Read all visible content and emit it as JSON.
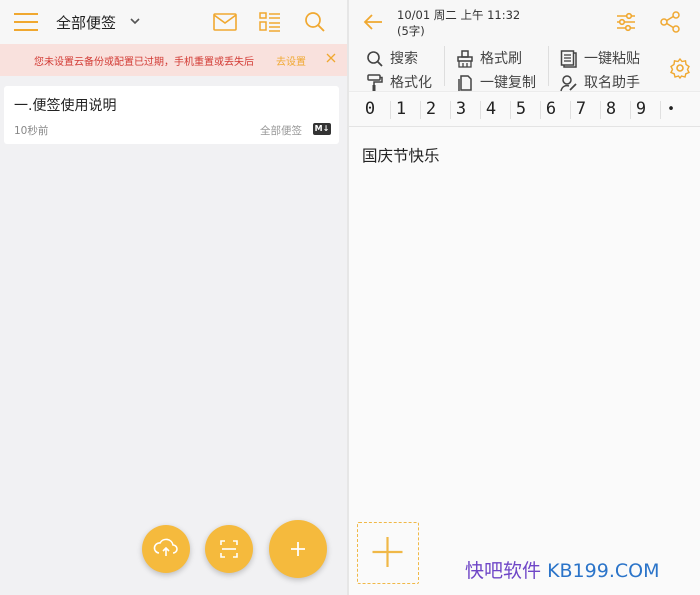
{
  "left": {
    "header": {
      "title": "全部便签",
      "icons": [
        "menu-icon",
        "chevron-down-icon",
        "mail-icon",
        "list-layout-icon",
        "search-icon"
      ]
    },
    "banner": {
      "text": "您未设置云备份或配置已过期，手机重置或丢失后",
      "action": "去设置",
      "bg": "#f9e1dd",
      "text_color": "#d23a34"
    },
    "notes": [
      {
        "title": "一.便签使用说明",
        "time": "10秒前",
        "category": "全部便签",
        "badge": "M↓"
      }
    ],
    "fabs": [
      "cloud-upload-icon",
      "scan-icon",
      "add-icon"
    ]
  },
  "right": {
    "header": {
      "date": "10/01 周二 上午 11:32",
      "count": "(5字)",
      "icons": [
        "back-arrow-icon",
        "settings-sliders-icon",
        "share-icon"
      ]
    },
    "toolbar": {
      "search": "搜索",
      "format": "格式化",
      "format_brush": "格式刷",
      "one_key_copy": "一键复制",
      "one_key_paste": "一键粘贴",
      "name_helper": "取名助手"
    },
    "numbers": [
      "0",
      "1",
      "2",
      "3",
      "4",
      "5",
      "6",
      "7",
      "8",
      "9",
      "•"
    ],
    "content": "国庆节快乐",
    "watermark": {
      "a": "快吧软件",
      "b": "KB199.COM"
    }
  },
  "colors": {
    "accent": "#f5ba3d",
    "accent_dark": "#f0a830"
  }
}
